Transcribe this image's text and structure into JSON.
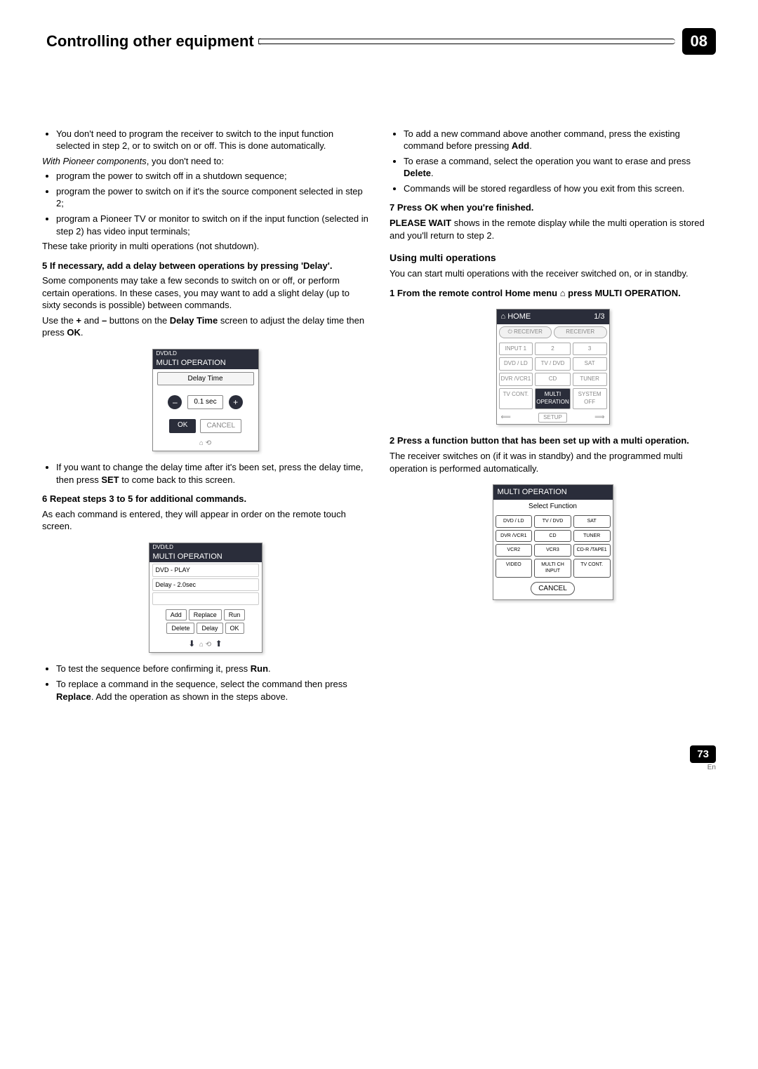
{
  "header": {
    "title": "Controlling other equipment",
    "chapter": "08"
  },
  "left": {
    "bullet_intro": "You don't need to program the receiver to switch to the input function selected in step 2, or to switch on or off. This is done automatically.",
    "pioneer_intro_prefix": "With Pioneer components",
    "pioneer_intro_rest": ", you don't need to:",
    "pioneer_bullets": [
      "program the power to switch off in a shutdown sequence;",
      "program the power to switch on if it's the source component selected in step 2;",
      "program a Pioneer TV or monitor to switch on if the input function (selected in step 2) has video input terminals;"
    ],
    "priority_note": "These take priority in multi operations (not shutdown).",
    "step5_head": "5   If necessary, add a delay between operations by pressing 'Delay'.",
    "step5_p1": "Some components may take a few seconds to switch on or off, or perform certain operations. In these cases, you may want to add a slight delay (up to sixty seconds is possible) between commands.",
    "step5_p2_a": "Use the ",
    "step5_p2_plus": "+",
    "step5_p2_b": " and ",
    "step5_p2_minus": "–",
    "step5_p2_c": " buttons on the ",
    "step5_p2_dt": "Delay Time",
    "step5_p2_d": " screen to adjust the delay time then press ",
    "step5_p2_ok": "OK",
    "step5_p2_e": ".",
    "delay_screen": {
      "top": "DVD/LD",
      "title": "MULTI OPERATION",
      "label": "Delay Time",
      "minus": "–",
      "value": "0.1 sec",
      "plus": "+",
      "ok": "OK",
      "cancel": "CANCEL"
    },
    "delay_note_a": "If you want to change the delay time after it's been set, press the delay time, then press ",
    "delay_note_set": "SET",
    "delay_note_b": " to come back to this screen.",
    "step6_head": "6   Repeat steps 3 to 5 for additional commands.",
    "step6_p": "As each command is entered, they will appear in order on the remote touch screen.",
    "cmd_screen": {
      "top": "DVD/LD",
      "title": "MULTI OPERATION",
      "row1": "DVD - PLAY",
      "row2": "Delay -    2.0sec",
      "btns": [
        "Add",
        "Replace",
        "Run",
        "Delete",
        "Delay",
        "OK"
      ]
    },
    "notes_after": [
      {
        "pre": "To test the sequence before confirming it, press ",
        "bold": "Run",
        "post": "."
      },
      {
        "pre": "To replace a command in the sequence, select the command then press ",
        "bold": "Replace",
        "post": ". Add the operation as shown in the steps above."
      }
    ]
  },
  "right": {
    "bullets_top": [
      {
        "pre": "To add a new command above another command, press the existing command before pressing ",
        "bold": "Add",
        "post": "."
      },
      {
        "pre": "To erase a command, select the operation you want to erase and press ",
        "bold": "Delete",
        "post": "."
      },
      {
        "pre": "Commands will be stored regardless of how you exit from this screen.",
        "bold": "",
        "post": ""
      }
    ],
    "step7_head": "7   Press OK when you're finished.",
    "step7_p_a": "PLEASE WAIT",
    "step7_p_b": " shows in the remote display while the multi operation is stored and you'll return to step 2.",
    "using_head": "Using multi operations",
    "using_p": "You can start multi operations with the receiver switched on, or in standby.",
    "step1_head_a": "1   From the remote control Home menu ",
    "step1_head_b": " press MULTI OPERATION.",
    "home_screen": {
      "title": "HOME",
      "page": "1/3",
      "recv1": "⏻ RECEIVER",
      "recv2": "RECEIVER",
      "cells": [
        "INPUT 1",
        "2",
        "3",
        "DVD / LD",
        "TV / DVD",
        "SAT",
        "DVR /VCR1",
        "CD",
        "TUNER",
        "TV CONT.",
        "MULTI OPERATION",
        "SYSTEM OFF"
      ],
      "setup": "SETUP"
    },
    "step2_head": "2   Press a function button that has been set up with a multi operation.",
    "step2_p": "The receiver switches on (if it was in standby) and the programmed multi operation is performed automatically.",
    "sel_screen": {
      "title": "MULTI OPERATION",
      "sub": "Select Function",
      "cells": [
        "DVD / LD",
        "TV / DVD",
        "SAT",
        "DVR /VCR1",
        "CD",
        "TUNER",
        "VCR2",
        "VCR3",
        "CD-R /TAPE1",
        "VIDEO",
        "MULTI CH INPUT",
        "TV CONT."
      ],
      "cancel": "CANCEL"
    }
  },
  "footer": {
    "page": "73",
    "lang": "En"
  }
}
